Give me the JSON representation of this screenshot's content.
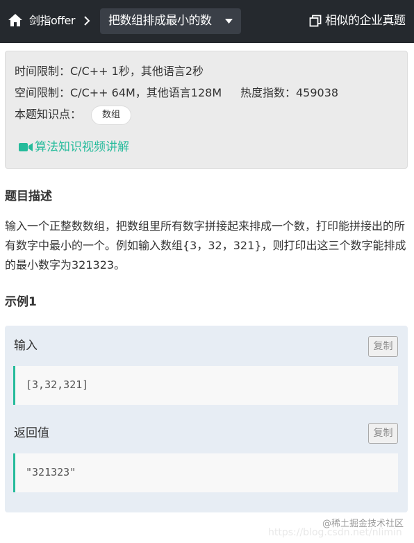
{
  "header": {
    "breadcrumb": "剑指offer",
    "problem_title": "把数组排成最小的数",
    "similar_link": "相似的企业真题"
  },
  "info": {
    "time_limit": "时间限制：C/C++ 1秒，其他语言2秒",
    "space_limit": "空间限制：C/C++ 64M，其他语言128M",
    "heat": "热度指数：459038",
    "knowledge_label": "本题知识点：",
    "knowledge_tag": "数组",
    "video_link": "算法知识视频讲解"
  },
  "description": {
    "heading": "题目描述",
    "text": "输入一个正整数数组，把数组里所有数字拼接起来排成一个数，打印能拼接出的所有数字中最小的一个。例如输入数组{3，32，321}，则打印出这三个数字能排成的最小数字为321323。"
  },
  "example": {
    "heading": "示例1",
    "input_label": "输入",
    "input_value": "[3,32,321]",
    "output_label": "返回值",
    "output_value": "\"321323\"",
    "copy_label": "复制"
  },
  "watermark": {
    "text": "@稀土掘金技术社区",
    "url_faint": "https://blog.csdn.net/nlimin"
  },
  "colors": {
    "header_bg": "#25292e",
    "accent_green": "#25bb9b",
    "info_bg": "#ebebeb",
    "example_bg": "#e7edf4"
  },
  "icons": [
    "home-icon",
    "chevron-right-icon",
    "caret-down-icon",
    "copy-pages-icon",
    "video-camera-icon"
  ]
}
